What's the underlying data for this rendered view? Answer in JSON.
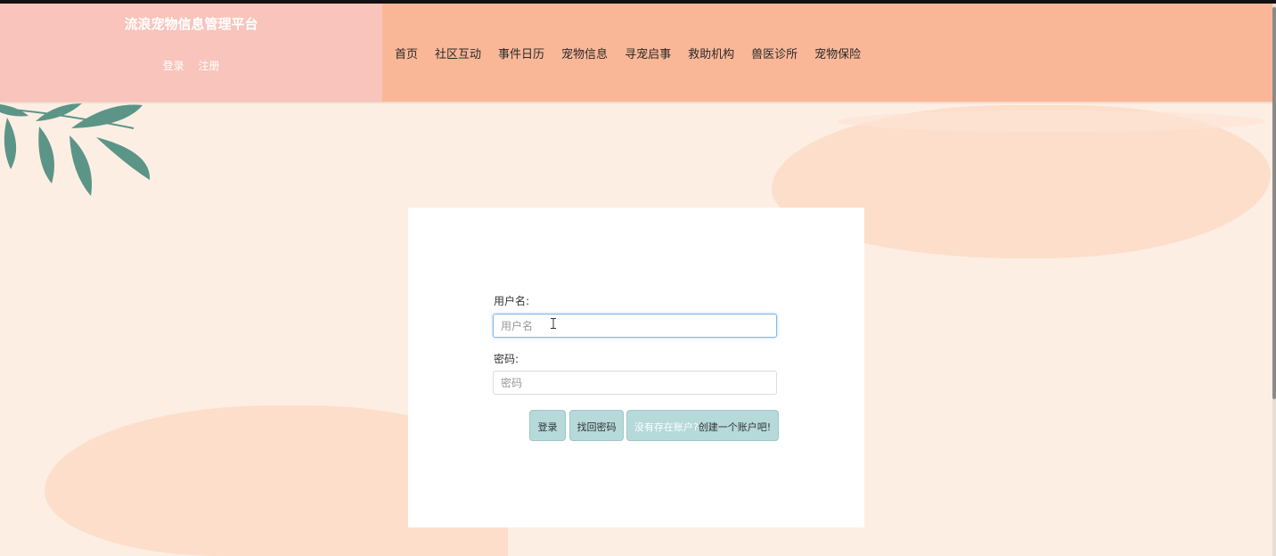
{
  "header": {
    "site_title": "流浪宠物信息管理平台",
    "login_link": "登录",
    "register_link": "注册",
    "nav": [
      "首页",
      "社区互动",
      "事件日历",
      "宠物信息",
      "寻宠启事",
      "救助机构",
      "兽医诊所",
      "宠物保险"
    ]
  },
  "login_form": {
    "username_label": "用户名:",
    "username_placeholder": "用户名",
    "password_label": "密码:",
    "password_placeholder": "密码",
    "login_button": "登录",
    "recover_button": "找回密码",
    "signup_prompt": "没有存在账户?",
    "signup_action": "创建一个账户吧!"
  },
  "colors": {
    "brand_bg": "#f8c4bb",
    "nav_bg": "#fab797",
    "page_bg": "#fdeee3",
    "button_bg": "#b6d9da",
    "leaf": "#5b9587"
  }
}
